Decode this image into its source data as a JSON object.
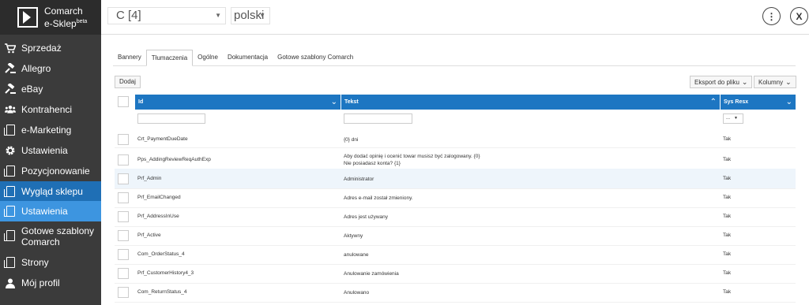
{
  "brand": {
    "line1": "Comarch",
    "line2": "e-Sklep",
    "beta": "beta"
  },
  "sidebar": {
    "items": [
      {
        "label": "Sprzedaż",
        "icon": "cart-icon"
      },
      {
        "label": "Allegro",
        "icon": "gavel-icon"
      },
      {
        "label": "eBay",
        "icon": "gavel-icon"
      },
      {
        "label": "Kontrahenci",
        "icon": "users-icon"
      },
      {
        "label": "e-Marketing",
        "icon": "pages-icon"
      },
      {
        "label": "Ustawienia",
        "icon": "gear-icon"
      },
      {
        "label": "Pozycjonowanie",
        "icon": "pages-icon"
      },
      {
        "label": "Wygląd sklepu",
        "icon": "pages-icon"
      },
      {
        "label": "Ustawienia",
        "icon": "pages-icon"
      },
      {
        "label": "Gotowe szablony Comarch",
        "icon": "pages-icon"
      },
      {
        "label": "Strony",
        "icon": "pages-icon"
      },
      {
        "label": "Mój profil",
        "icon": "user-icon"
      }
    ]
  },
  "topbar": {
    "template_select": "C [4]",
    "language_select": "polski"
  },
  "tabs": [
    "Bannery",
    "Tłumaczenia",
    "Ogólne",
    "Dokumentacja",
    "Gotowe szablony Comarch"
  ],
  "toolbar": {
    "add": "Dodaj",
    "export": "Eksport do pliku",
    "columns": "Kolumny"
  },
  "grid": {
    "headers": {
      "id": "Id",
      "text": "Tekst",
      "sys": "Sys Resx"
    },
    "sys_filter": "...",
    "rows": [
      {
        "id": "Crt_PaymentDueDate",
        "text": "{0} dni",
        "sys": "Tak"
      },
      {
        "id": "Pps_AddingReviewReqAuthExp",
        "text": "Aby dodać opinię i ocenić towar musisz być zalogowany. {0}",
        "text2": "Nie posiadasz konta? {1}",
        "sys": "Tak"
      },
      {
        "id": "Prf_Admin",
        "text": "Administrator",
        "sys": "Tak"
      },
      {
        "id": "Prf_EmailChanged",
        "text": "Adres e-mail został zmieniony.",
        "sys": "Tak"
      },
      {
        "id": "Prf_AddressInUse",
        "text": "Adres jest używany",
        "sys": "Tak"
      },
      {
        "id": "Prf_Active",
        "text": "Aktywny",
        "sys": "Tak"
      },
      {
        "id": "Com_OrderStatus_4",
        "text": "anulowane",
        "sys": "Tak"
      },
      {
        "id": "Prf_CustomerHistory4_3",
        "text": "Anulowanie zamówienia",
        "sys": "Tak"
      },
      {
        "id": "Com_ReturnStatus_4",
        "text": "Anulowano",
        "sys": "Tak"
      }
    ]
  },
  "colors": {
    "sidebar": "#3b3b3b",
    "active_nav": "#1f6fb5",
    "active_sub": "#3d95e0",
    "grid_header": "#1d76c2"
  }
}
